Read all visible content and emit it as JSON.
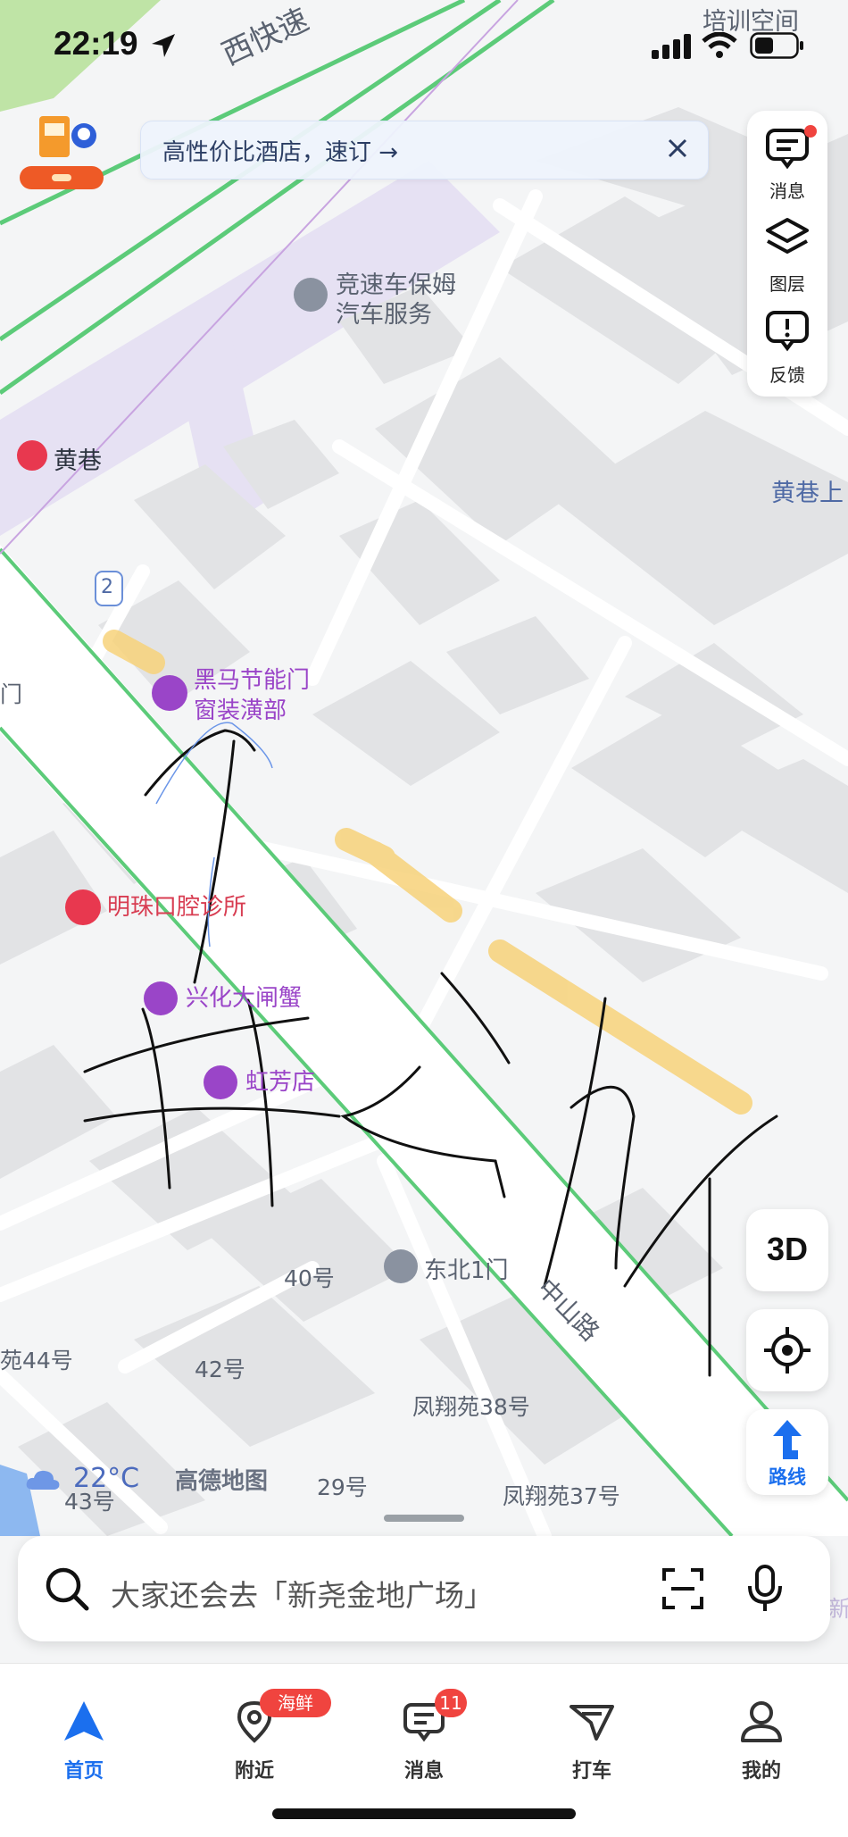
{
  "status_bar": {
    "time": "22:19"
  },
  "banner": {
    "text": "高性价比酒店，速订 →"
  },
  "side_panel": [
    {
      "label": "消息",
      "icon": "message-icon"
    },
    {
      "label": "图层",
      "icon": "layers-icon"
    },
    {
      "label": "反馈",
      "icon": "feedback-icon"
    }
  ],
  "map": {
    "labels": {
      "road_west": "西快速",
      "training_space": "培训空间",
      "car_service_line1": "竞速车保姆",
      "car_service_line2": "汽车服务",
      "huangxiang": "黄巷",
      "huangxiang_right": "黄巷上",
      "route_number": "2",
      "heima_line1": "黑马节能门",
      "heima_line2": "窗装潢部",
      "dental": "明珠口腔诊所",
      "xinghua": "兴化大闸蟹",
      "hongfang": "虹芳店",
      "dongbei_gate": "东北1门",
      "zhongshan_road": "中山路",
      "no40": "40号",
      "no42": "42号",
      "yuan44": "苑44号",
      "fengxiang38": "凤翔苑38号",
      "no29": "29号",
      "no43": "43号",
      "fengxiang37": "凤翔苑37号",
      "edge_left": "门",
      "edge_right": "新"
    },
    "weather": "22°C",
    "brand": "高德地图",
    "btn_3d": "3D",
    "route_label": "路线"
  },
  "search": {
    "placeholder": "大家还会去「新尧金地广场」"
  },
  "bottom_nav": [
    {
      "label": "首页",
      "icon": "navigate-arrow-icon",
      "active": true
    },
    {
      "label": "附近",
      "icon": "location-pin-icon",
      "badge": "海鲜"
    },
    {
      "label": "消息",
      "icon": "message-icon",
      "badge": "11"
    },
    {
      "label": "打车",
      "icon": "taxi-icon"
    },
    {
      "label": "我的",
      "icon": "person-icon"
    }
  ],
  "colors": {
    "road_green": "#5ccb79",
    "highlight_yellow": "#f7d27a",
    "accent_blue": "#1b6fee",
    "poi_purple": "#9a45c8",
    "badge_red": "#f0443f"
  }
}
